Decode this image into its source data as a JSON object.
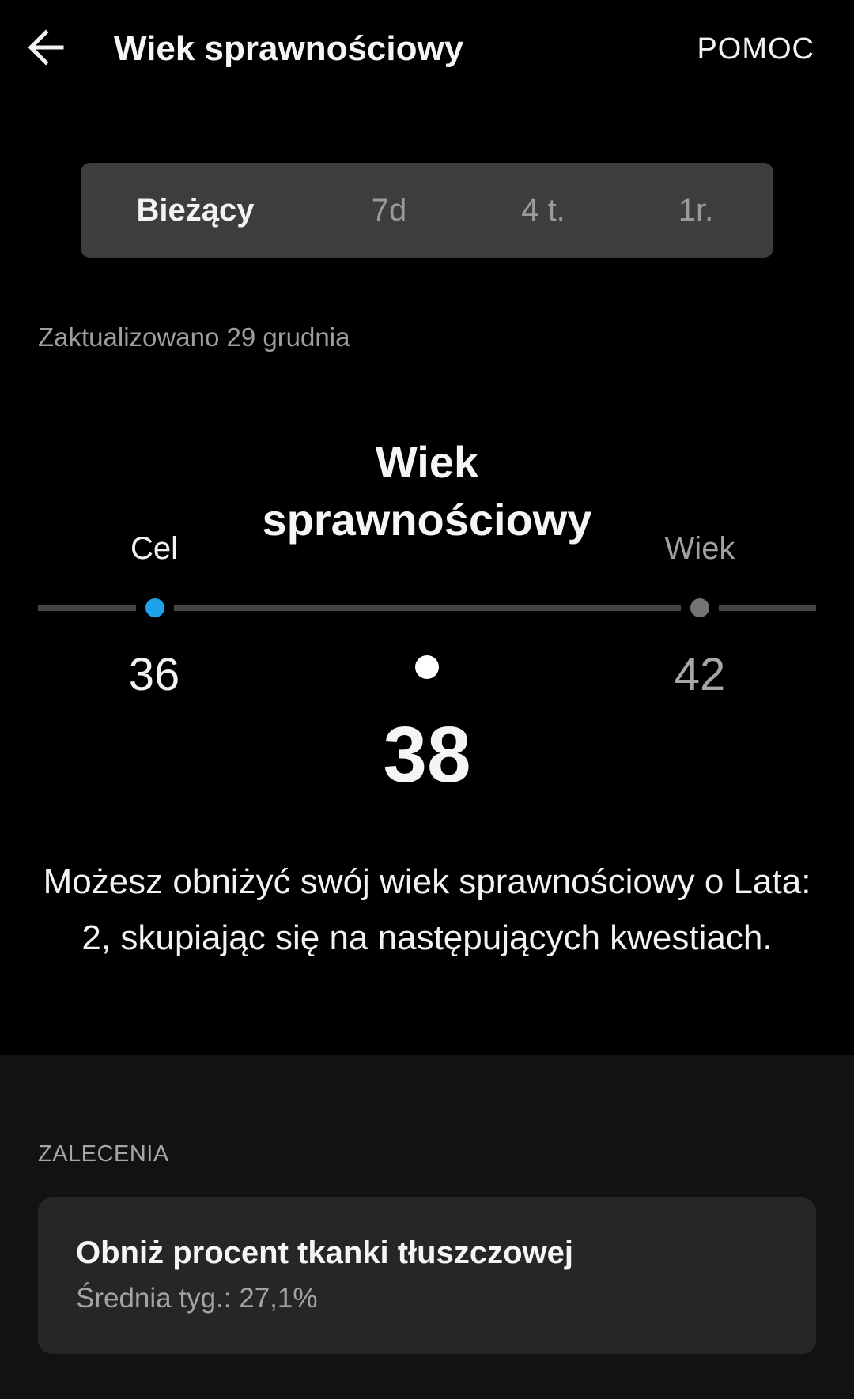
{
  "header": {
    "back_icon": "arrow-left-icon",
    "title": "Wiek sprawnościowy",
    "help_label": "POMOC"
  },
  "tabs": [
    {
      "label": "Bieżący",
      "active": true
    },
    {
      "label": "7d",
      "active": false
    },
    {
      "label": "4 t.",
      "active": false
    },
    {
      "label": "1r.",
      "active": false
    }
  ],
  "updated_text": "Zaktualizowano 29 grudnia",
  "gauge": {
    "center_label": "Wiek sprawnościowy",
    "goal": {
      "label": "Cel",
      "value": "36",
      "color": "#1ea3ea"
    },
    "age": {
      "label": "Wiek",
      "value": "42",
      "color": "#747474"
    },
    "current": {
      "value": "38",
      "color": "#ffffff"
    }
  },
  "description": "Możesz obniżyć swój wiek sprawnościowy o Lata: 2, skupiając się na następujących kwestiach.",
  "recommendations": {
    "section_label": "ZALECENIA",
    "items": [
      {
        "title": "Obniż procent tkanki tłuszczowej",
        "subtitle": "Średnia tyg.: 27,1%"
      }
    ]
  }
}
